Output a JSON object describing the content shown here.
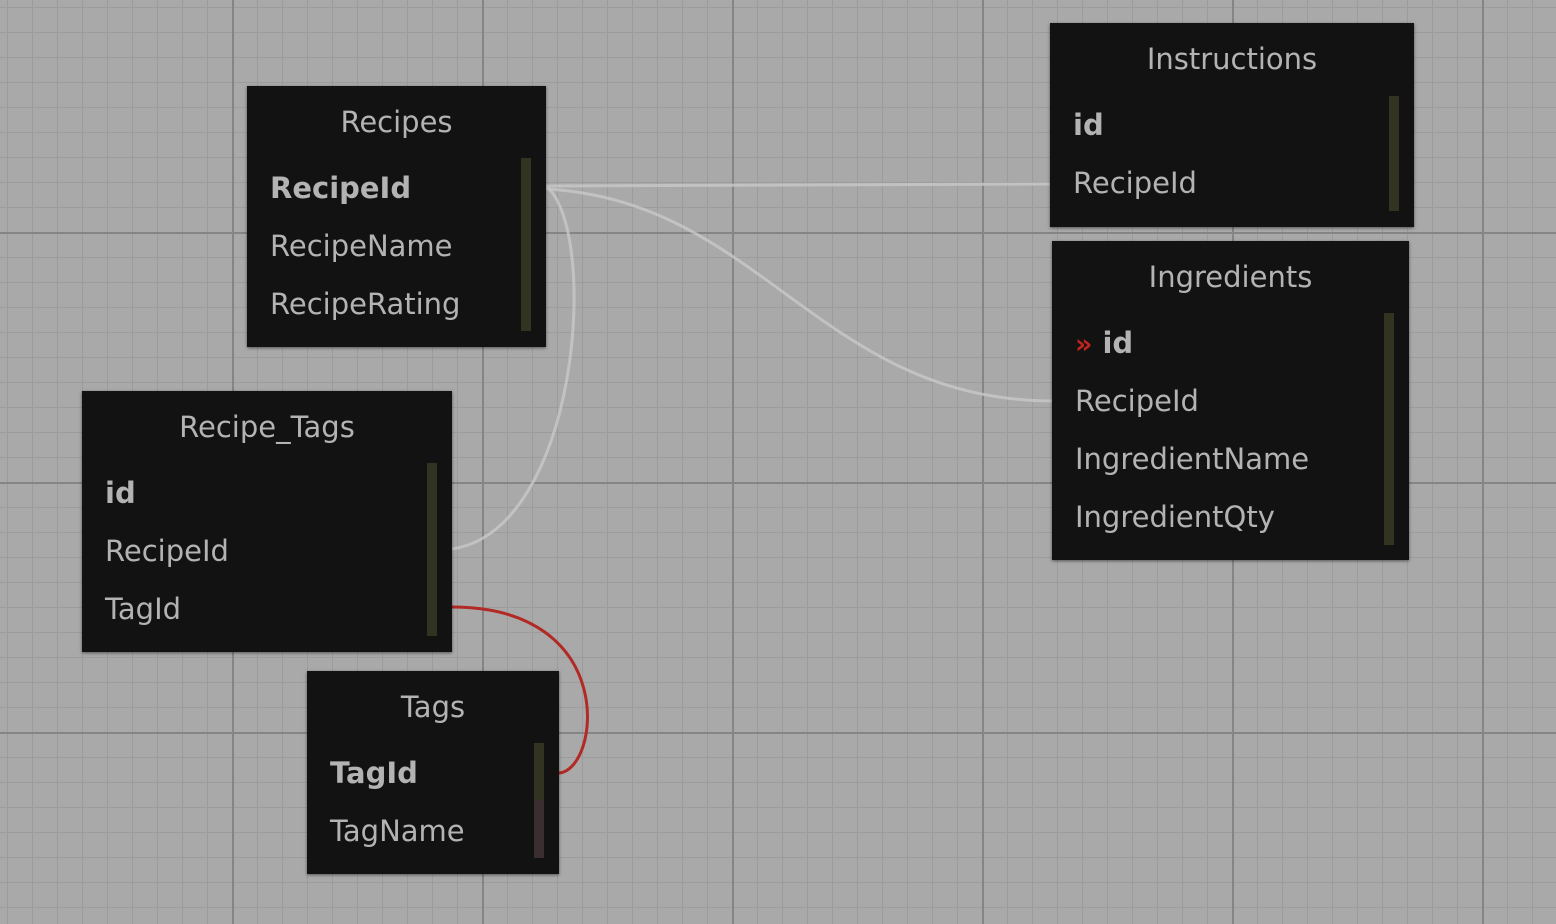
{
  "tables": {
    "recipes": {
      "title": "Recipes",
      "fields": [
        "RecipeId",
        "RecipeName",
        "RecipeRating"
      ]
    },
    "instructions": {
      "title": "Instructions",
      "fields": [
        "id",
        "RecipeId"
      ]
    },
    "ingredients": {
      "title": "Ingredients",
      "fk_marker": "»",
      "fields": [
        "id",
        "RecipeId",
        "IngredientName",
        "IngredientQty"
      ]
    },
    "recipe_tags": {
      "title": "Recipe_Tags",
      "fields": [
        "id",
        "RecipeId",
        "TagId"
      ]
    },
    "tags": {
      "title": "Tags",
      "fields": [
        "TagId",
        "TagName"
      ]
    }
  },
  "colors": {
    "canvas": "#a9a9a9",
    "table_bg": "#121212",
    "text": "#b3b3b3",
    "link": "#c8c8c8",
    "link_selected": "#b22a26",
    "scrollbar": "#323321"
  }
}
